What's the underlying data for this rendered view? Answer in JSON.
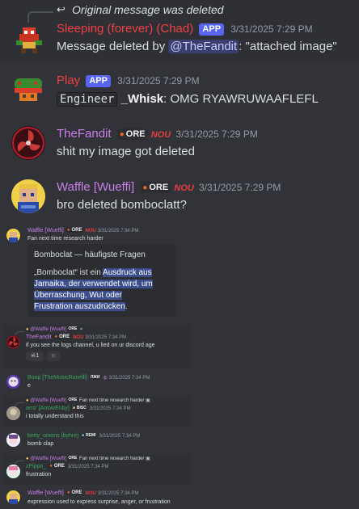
{
  "m1": {
    "reply_text": "Original message was deleted",
    "username": "Sleeping (forever) (Chad)",
    "app": "APP",
    "time": "3/31/2025 7:29 PM",
    "text_a": "Message deleted by ",
    "mention": "@TheFandit",
    "text_b": ": \"attached image\""
  },
  "m2": {
    "username": "Play",
    "app": "APP",
    "time": "3/31/2025 7:29 PM",
    "code": "Engineer",
    "bold": "_Whisk",
    "text": ":  OMG RYAWRUWAAFLEFL"
  },
  "m3": {
    "username": "TheFandit",
    "tag": "ORE",
    "time": "3/31/2025 7:29 PM",
    "text": "shit my image got deleted"
  },
  "m4": {
    "username": "Waffle [Wueffi]",
    "tag": "ORE",
    "time": "3/31/2025 7:29 PM",
    "text": "bro deleted bomboclatt?"
  },
  "s1": {
    "username": "Waffle [Wueffi]",
    "tag": "ORE",
    "time": "3/31/2025 7:34 PM",
    "text": "Fan next time research harder",
    "embed_title": "Bomboclat — häufigste Fragen",
    "embed_pre": "„Bomboclat“ ist ein ",
    "embed_sel1": "Ausdruck aus",
    "embed_sel2": "Jamaika, der verwendet wird, um",
    "embed_sel3": "Überraschung, Wut oder",
    "embed_sel4": "Frustration auszudrücken",
    "embed_post": "."
  },
  "s2": {
    "reply_user": "@Waffle [Wueffi]",
    "reply_tag": "ORE",
    "username": "TheFandit",
    "tag": "ORE",
    "time": "3/31/2025 7:34 PM",
    "text": "if you see the logs channel, u lied on ur discord age",
    "reaction_count": "1"
  },
  "s3": {
    "username": "Boop [TheMusicRunelll]",
    "tag": "ЛЖИ",
    "time": "3/31/2025 7:34 PM",
    "text": "e"
  },
  "s4": {
    "reply_user": "@Waffle [Wueffi]",
    "reply_tag": "ORE",
    "reply_text": "Fan next time research harder",
    "username": "arro' [ArrowEnby]",
    "tag": "BISC",
    "time": "3/31/2025 7:34 PM",
    "text": "i totally understand this"
  },
  "s5": {
    "username": "betty_onions [byhre]",
    "tag": "REMI",
    "time": "3/31/2025 7:34 PM",
    "text": "bomb clap"
  },
  "s6": {
    "reply_user": "@Waffle [Wueffi]",
    "reply_tag": "ORE",
    "reply_text": "Fan next time research harder",
    "username": "zPippo_",
    "tag": "ORE",
    "time": "3/31/2025 7:34 PM",
    "text": "frustration"
  },
  "s7": {
    "username": "Waffle [Wueffi]",
    "tag": "ORE",
    "time": "3/31/2025 7:34 PM",
    "text": "expression used to express surprise, anger, or frustration"
  },
  "colors": {
    "bg": "#313338",
    "red": "#f23f43",
    "purple": "#c97fe8",
    "green": "#3ba55c",
    "blurple": "#5865f2"
  }
}
